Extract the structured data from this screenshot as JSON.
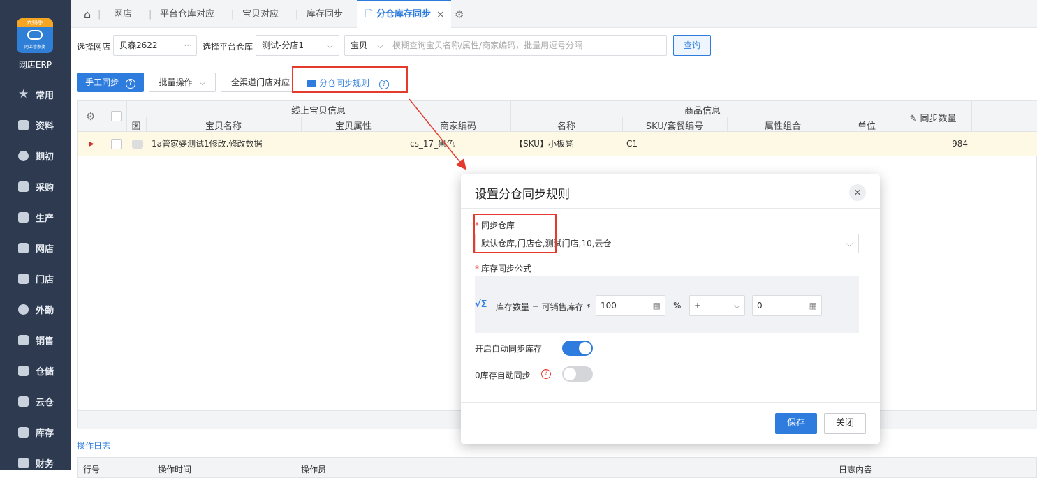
{
  "sidebar": {
    "logo_top": "六蚂手",
    "logo_sub": "网上管家婆",
    "app_name": "网店ERP",
    "items": [
      {
        "label": "常用",
        "icon": "star-icon"
      },
      {
        "label": "资料",
        "icon": "data-icon"
      },
      {
        "label": "期初",
        "icon": "target-icon"
      },
      {
        "label": "采购",
        "icon": "purchase-icon"
      },
      {
        "label": "生产",
        "icon": "production-icon"
      },
      {
        "label": "网店",
        "icon": "shop-icon"
      },
      {
        "label": "门店",
        "icon": "store-pie-icon"
      },
      {
        "label": "外勤",
        "icon": "field-icon"
      },
      {
        "label": "销售",
        "icon": "sales-chart-icon"
      },
      {
        "label": "仓储",
        "icon": "warehouse-icon"
      },
      {
        "label": "云仓",
        "icon": "cloud-warehouse-icon"
      },
      {
        "label": "库存",
        "icon": "inventory-icon"
      },
      {
        "label": "财务",
        "icon": "finance-icon"
      }
    ]
  },
  "tabs": {
    "home_icon": "home-icon",
    "items": [
      "网店",
      "平台仓库对应",
      "宝贝对应",
      "库存同步"
    ],
    "active": "分仓库存同步",
    "close": "×"
  },
  "filter": {
    "shop_label": "选择网店",
    "shop_value": "贝森2622",
    "shop_more": "···",
    "wh_label": "选择平台仓库",
    "wh_value": "测试-分店1",
    "type_value": "宝贝",
    "search_placeholder": "模糊查询宝贝名称/属性/商家编码，批量用逗号分隔",
    "query": "查询"
  },
  "toolbar": {
    "manual_sync": "手工同步",
    "batch": "批量操作",
    "all_channel": "全渠道门店对应",
    "rule": "分仓同步规则"
  },
  "grid": {
    "group_online": "线上宝贝信息",
    "group_goods": "商品信息",
    "col_img": "图",
    "col_name": "宝贝名称",
    "col_attr": "宝贝属性",
    "col_code": "商家编码",
    "col_gname": "名称",
    "col_sku": "SKU/套餐编号",
    "col_combo": "属性组合",
    "col_unit": "单位",
    "col_qty": "同步数量",
    "row": {
      "arrow": "▶",
      "name": "1a管家婆测试1修改.修改数据",
      "attr": "",
      "code": "cs_17_黑色",
      "gname": "【SKU】小板凳",
      "sku": "C1",
      "combo": "",
      "unit": "",
      "qty": "984"
    }
  },
  "log": {
    "title": "操作日志",
    "col_no": "行号",
    "col_time": "操作时间",
    "col_user": "操作员",
    "col_content": "日志内容"
  },
  "modal": {
    "title": "设置分仓同步规则",
    "close": "×",
    "wh_label": "同步仓库",
    "wh_value": "默认仓库,门店仓,测试门店,10,云仓",
    "formula_label": "库存同步公式",
    "formula_icon": "√Σ",
    "formula_text": "库存数量 = 可销售库存 *",
    "percent_value": "100",
    "percent_sign": "%",
    "op_value": "+",
    "add_value": "0",
    "auto_sync_label": "开启自动同步库存",
    "auto_sync_on": true,
    "zero_sync_label": "0库存自动同步",
    "zero_sync_on": false,
    "save": "保存",
    "cancel": "关闭"
  },
  "colors": {
    "accent": "#2e7dde",
    "sidebar_bg": "#2d3a4f",
    "highlight_red": "#e53b2f",
    "row_highlight": "#fdf9e5"
  }
}
